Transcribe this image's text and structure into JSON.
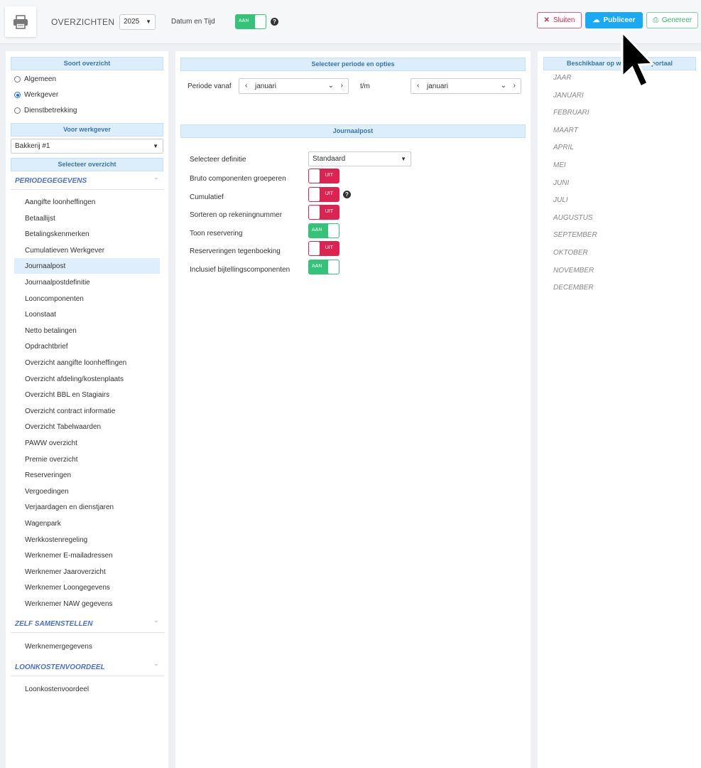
{
  "header": {
    "title": "OVERZICHTEN",
    "year": "2025",
    "datum_label": "Datum en Tijd",
    "datum_toggle": "AAN",
    "close": "Sluiten",
    "publish": "Publiceer",
    "generate": "Genereer"
  },
  "left": {
    "soort_header": "Soort overzicht",
    "radios": [
      "Algemeen",
      "Werkgever",
      "Dienstbetrekking"
    ],
    "selected_radio": "Werkgever",
    "werkgever_header": "Voor werkgever",
    "werkgever": "Bakkerij #1",
    "select_header": "Selecteer overzicht",
    "sections": [
      {
        "title": "PERIODEGEGEVENS",
        "items": [
          "Aangifte loonheffingen",
          "Betaallijst",
          "Betalingskenmerken",
          "Cumulatieven Werkgever",
          "Journaalpost",
          "Journaalpostdefinitie",
          "Looncomponenten",
          "Loonstaat",
          "Netto betalingen",
          "Opdrachtbrief",
          "Overzicht aangifte loonheffingen",
          "Overzicht afdeling/kostenplaats",
          "Overzicht BBL en Stagiairs",
          "Overzicht contract informatie",
          "Overzicht Tabelwaarden",
          "PAWW overzicht",
          "Premie overzicht",
          "Reserveringen",
          "Vergoedingen",
          "Verjaardagen en dienstjaren",
          "Wagenpark",
          "Werkkostenregeling",
          "Werknemer E-mailadressen",
          "Werknemer Jaaroverzicht",
          "Werknemer Loongegevens",
          "Werknemer NAW gegevens"
        ]
      },
      {
        "title": "ZELF SAMENSTELLEN",
        "items": [
          "Werknemergegevens"
        ]
      },
      {
        "title": "LOONKOSTENVOORDEEL",
        "items": [
          "Loonkostenvoordeel"
        ]
      }
    ],
    "active_item": "Journaalpost"
  },
  "middle": {
    "periode_header": "Selecteer periode en opties",
    "periode_label": "Periode vanaf",
    "from": "januari",
    "tm_label": "t/m",
    "to": "januari",
    "journaal_header": "Journaalpost",
    "definitie_label": "Selecteer definitie",
    "definitie": "Standaard",
    "options": [
      {
        "label": "Bruto componenten groeperen",
        "state": "UIT"
      },
      {
        "label": "Cumulatief",
        "state": "UIT",
        "help": true
      },
      {
        "label": "Sorteren op rekeningnummer",
        "state": "UIT"
      },
      {
        "label": "Toon reservering",
        "state": "AAN"
      },
      {
        "label": "Reserveringen tegenboeking",
        "state": "UIT"
      },
      {
        "label": "Inclusief bijtellingscomponenten",
        "state": "AAN"
      }
    ]
  },
  "right": {
    "header": "Beschikbaar op werkgeversportaal",
    "months": [
      "JAAR",
      "JANUARI",
      "FEBRUARI",
      "MAART",
      "APRIL",
      "MEI",
      "JUNI",
      "JULI",
      "AUGUSTUS",
      "SEPTEMBER",
      "OKTOBER",
      "NOVEMBER",
      "DECEMBER"
    ]
  }
}
